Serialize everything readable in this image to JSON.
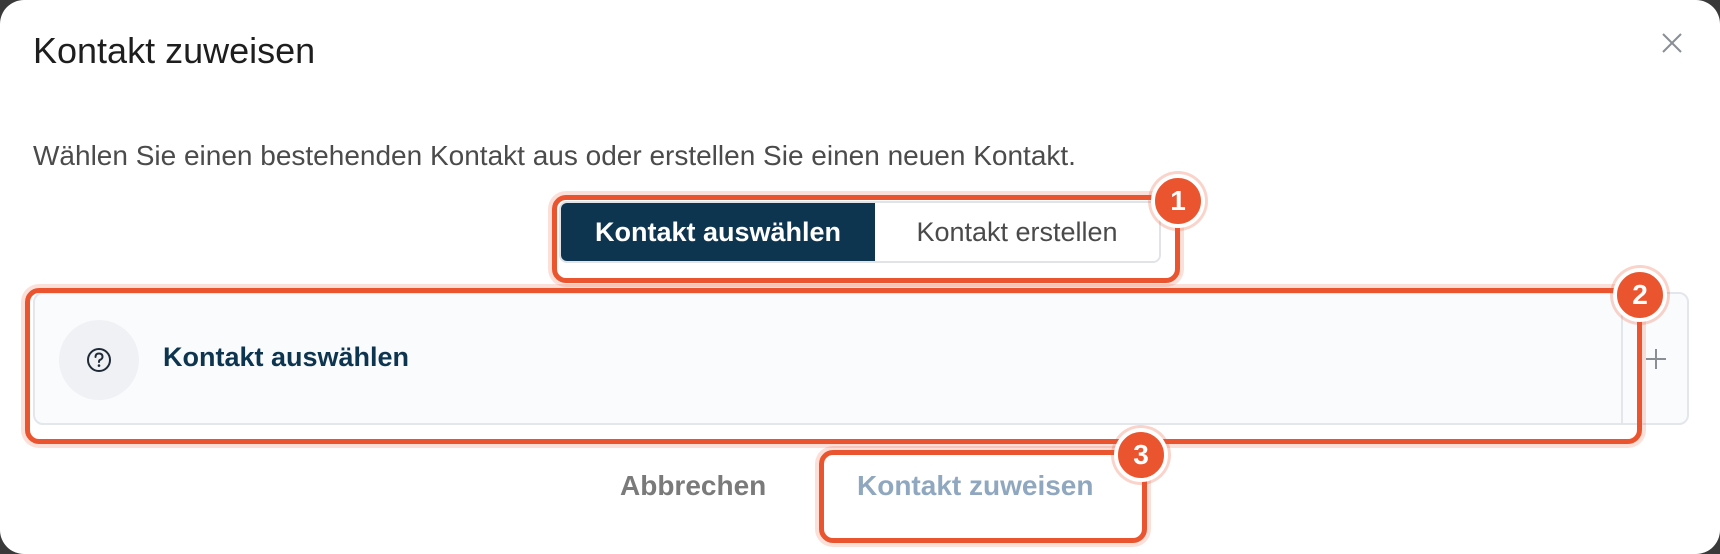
{
  "dialog": {
    "title": "Kontakt zuweisen",
    "description": "Wählen Sie einen bestehenden Kontakt aus oder erstellen Sie einen neuen Kontakt."
  },
  "segments": {
    "select_label": "Kontakt auswählen",
    "create_label": "Kontakt erstellen",
    "active": "Kontakt auswählen"
  },
  "contact_picker": {
    "label": "Kontakt auswählen",
    "icon": "question-circle-icon",
    "add_icon": "plus-icon"
  },
  "footer": {
    "cancel_label": "Abbrechen",
    "assign_label": "Kontakt zuweisen"
  },
  "callouts": [
    "1",
    "2",
    "3"
  ],
  "colors": {
    "primary": "#0e3550",
    "callout": "#ea5530",
    "disabled_text": "#8fa7bf"
  }
}
